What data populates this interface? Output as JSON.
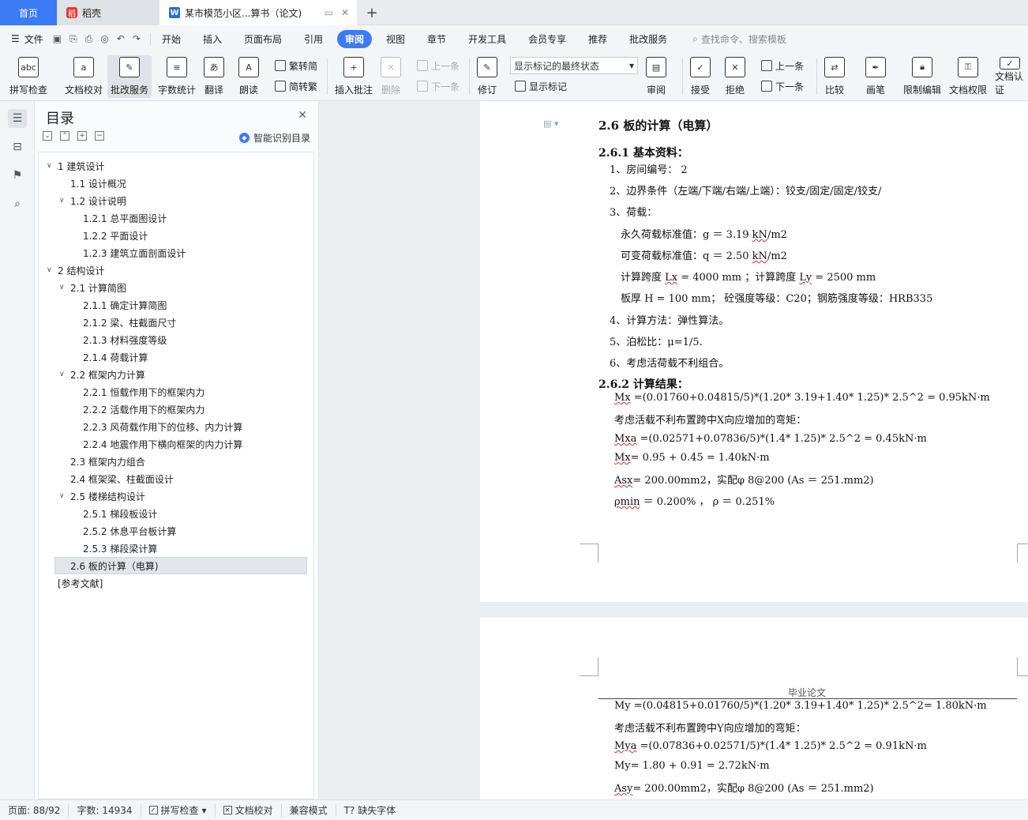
{
  "tabs": {
    "home": "首页",
    "daoke": "稻壳",
    "doc": "某市模范小区...算书（论文)",
    "add": "+"
  },
  "menu": {
    "file": "文件",
    "items": [
      "开始",
      "插入",
      "页面布局",
      "引用",
      "审阅",
      "视图",
      "章节",
      "开发工具",
      "会员专享",
      "推荐",
      "批改服务"
    ],
    "active_index": 4,
    "search": "查找命令、搜索模板"
  },
  "ribbon": {
    "spell": "拼写检查",
    "proof": "文档校对",
    "review_service": "批改服务",
    "word_count": "字数统计",
    "translate": "翻译",
    "read": "朗读",
    "to_trad": "繁转简",
    "to_simp": "简转繁",
    "insert_comment": "插入批注",
    "delete": "删除",
    "prev": "上一条",
    "next": "下一条",
    "track": "修订",
    "show_mode": "显示标记的最终状态",
    "show_marks": "显示标记",
    "reviewer": "审阅",
    "accept": "接受",
    "reject": "拒绝",
    "prev2": "上一条",
    "next2": "下一条",
    "compare": "比较",
    "pen": "画笔",
    "restrict": "限制编辑",
    "perm": "文档权限",
    "cert": "文档认证"
  },
  "toc": {
    "title": "目录",
    "smart": "智能识别目录",
    "items": [
      "1  建筑设计",
      "1.1  设计概况",
      "1.2  设计说明",
      "1.2.1  总平面图设计",
      "1.2.2  平面设计",
      "1.2.3 建筑立面剖面设计",
      "2  结构设计",
      "2.1  计算简图",
      "2.1.1  确定计算简图",
      "2.1.2  梁、柱截面尺寸",
      "2.1.3  材料强度等级",
      "2.1.4  荷载计算",
      "2.2  框架内力计算",
      "2.2.1  恒载作用下的框架内力",
      "2.2.2  活载作用下的框架内力",
      "2.2.3  风荷载作用下的位移、内力计算",
      "2.2.4 地震作用下横向框架的内力计算",
      "2.3  框架内力组合",
      "2.4  框架梁、柱截面设计",
      "2.5 楼梯结构设计",
      "2.5.1  梯段板设计",
      "2.5.2  休息平台板计算",
      "2.5.3  梯段梁计算",
      "2.6 板的计算（电算)",
      "[参考文献]"
    ]
  },
  "doc": {
    "h26": "2.6 板的计算（电算）",
    "h261": "2.6.1  基本资料：",
    "l1": "1、房间编号：    2",
    "l2": "2、边界条件（左端/下端/右端/上端）：铰支/固定/固定/铰支/",
    "l3": "3、荷载：",
    "l4a": "永久荷载标准值：g  ＝    3.19 ",
    "l4b": "kN",
    "l4c": "/m2",
    "l5a": "可变荷载标准值：q  ＝    2.50 ",
    "l5b": "kN",
    "l5c": "/m2",
    "l6a": "计算跨度    ",
    "l6b": "Lx",
    "l6c": " =     4000 mm    ；计算跨度    ",
    "l6d": "Ly",
    "l6e": " =     2500 mm",
    "l7": "板厚    H =       100 mm；    砼强度等级：C20；钢筋强度等级：HRB335",
    "l8": "4、计算方法：弹性算法。",
    "l9": "5、泊松比：μ=1/5.",
    "l10": "6、考虑活荷载不利组合。",
    "h262": "2.6.2  计算结果：",
    "r1a": "Mx",
    "r1b": " =(0.01760+0.04815/5)*(1.20* 3.19+1.40* 1.25)* 2.5^2 = 0.95kN·m",
    "r2": "考虑活载不利布置跨中X向应增加的弯矩：",
    "r3a": "Mxa",
    "r3b": " =(0.02571+0.07836/5)*(1.4* 1.25)* 2.5^2 = 0.45kN·m",
    "r4a": "Mx",
    "r4b": "= 0.95 + 0.45 = 1.40kN·m",
    "r5a": "Asx",
    "r5b": "= 200.00mm2，实配φ 8@200 (As  ＝  251.mm2)",
    "r6a": "ρmin",
    "r6b": "  ＝  0.200%    ，  ρ  ＝  0.251%",
    "header2": "毕业论文",
    "p2l1": "My =(0.04815+0.01760/5)*(1.20* 3.19+1.40* 1.25)* 2.5^2= 1.80kN·m",
    "p2l2": "考虑活载不利布置跨中Y向应增加的弯矩：",
    "p2l3a": "Mya",
    "p2l3b": " =(0.07836+0.02571/5)*(1.4* 1.25)* 2.5^2 = 0.91kN·m",
    "p2l4": "My= 1.80 + 0.91 = 2.72kN·m",
    "p2l5a": "Asy",
    "p2l5b": "= 200.00mm2，实配φ 8@200 (As  ＝  251.mm2)"
  },
  "status": {
    "page": "页面: 88/92",
    "words": "字数: 14934",
    "spell": "拼写检查",
    "proof": "文档校对",
    "compat": "兼容模式",
    "font": "缺失字体"
  },
  "colors": {
    "accent": "#3b7bf6",
    "daoke": "#e53935"
  }
}
